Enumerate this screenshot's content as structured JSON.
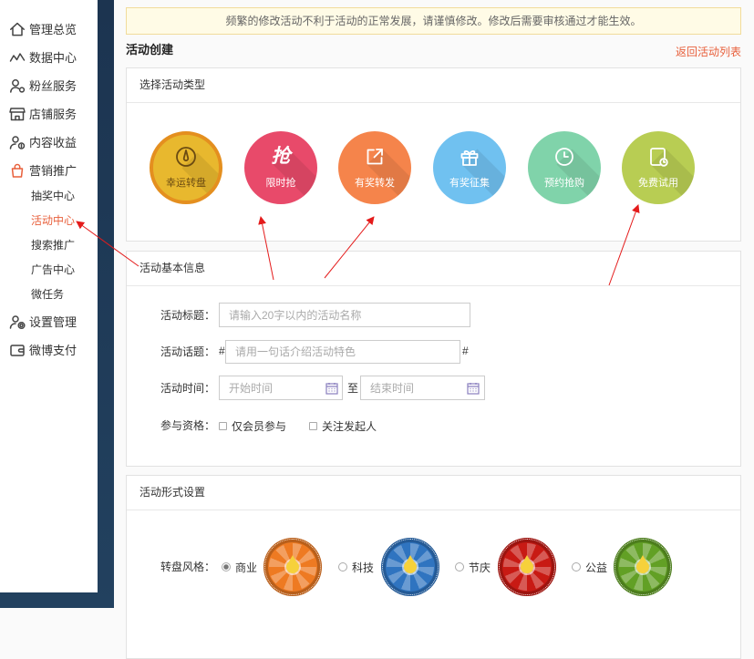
{
  "notice": "频繁的修改活动不利于活动的正常发展，请谨慎修改。修改后需要审核通过才能生效。",
  "header": {
    "title": "活动创建",
    "back_link": "返回活动列表"
  },
  "sidebar": {
    "items": [
      {
        "label": "管理总览",
        "icon": "home-icon"
      },
      {
        "label": "数据中心",
        "icon": "chart-icon"
      },
      {
        "label": "粉丝服务",
        "icon": "fans-icon"
      },
      {
        "label": "店铺服务",
        "icon": "store-icon"
      },
      {
        "label": "内容收益",
        "icon": "income-icon"
      },
      {
        "label": "营销推广",
        "icon": "bag-icon",
        "active": true
      }
    ],
    "subitems": [
      {
        "label": "抽奖中心",
        "active": false
      },
      {
        "label": "活动中心",
        "active": true
      },
      {
        "label": "搜索推广",
        "active": false
      },
      {
        "label": "广告中心",
        "active": false
      },
      {
        "label": "微任务",
        "active": false
      }
    ],
    "bottom_items": [
      {
        "label": "设置管理",
        "icon": "user-settings-icon"
      },
      {
        "label": "微博支付",
        "icon": "wallet-icon"
      }
    ]
  },
  "type_panel": {
    "title": "选择活动类型",
    "ring_color": "#e48f1f",
    "types": [
      {
        "label": "幸运转盘",
        "icon": "dial-icon",
        "color": "#e8b82e",
        "selected": true
      },
      {
        "label": "限时抢",
        "icon": "grab-icon",
        "glyph": "抢",
        "color": "#e84a6a",
        "selected": false
      },
      {
        "label": "有奖转发",
        "icon": "share-icon",
        "color": "#f5844b",
        "selected": false
      },
      {
        "label": "有奖征集",
        "icon": "gift-icon",
        "color": "#70c1f0",
        "selected": false
      },
      {
        "label": "预约抢购",
        "icon": "clock-icon",
        "color": "#80d3aa",
        "selected": false
      },
      {
        "label": "免费试用",
        "icon": "trial-icon",
        "color": "#b8cd53",
        "selected": false
      }
    ]
  },
  "basic_panel": {
    "title": "活动基本信息",
    "fields": {
      "title": {
        "label": "活动标题：",
        "value": "",
        "placeholder": "请输入20字以内的活动名称"
      },
      "topic": {
        "label": "活动话题：",
        "prefix": "#",
        "suffix": "#",
        "value": "",
        "placeholder": "请用一句话介绍活动特色"
      },
      "time": {
        "label": "活动时间：",
        "start_placeholder": "开始时间",
        "separator": "至",
        "end_placeholder": "结束时间"
      },
      "eligibility": {
        "label": "参与资格：",
        "options": [
          {
            "label": "仅会员参与",
            "checked": false
          },
          {
            "label": "关注发起人",
            "checked": false
          }
        ]
      }
    }
  },
  "style_panel": {
    "title": "活动形式设置",
    "wheel_style": {
      "label": "转盘风格：",
      "options": [
        {
          "label": "商业",
          "color": "#ee7a22",
          "selected": true
        },
        {
          "label": "科技",
          "color": "#2f74c0",
          "selected": false
        },
        {
          "label": "节庆",
          "color": "#c81a14",
          "selected": false
        },
        {
          "label": "公益",
          "color": "#62a025",
          "selected": false
        }
      ]
    }
  },
  "colors": {
    "accent": "#e8603c",
    "notice_bg": "#fffbe6",
    "annotation": "#e41b1b"
  }
}
